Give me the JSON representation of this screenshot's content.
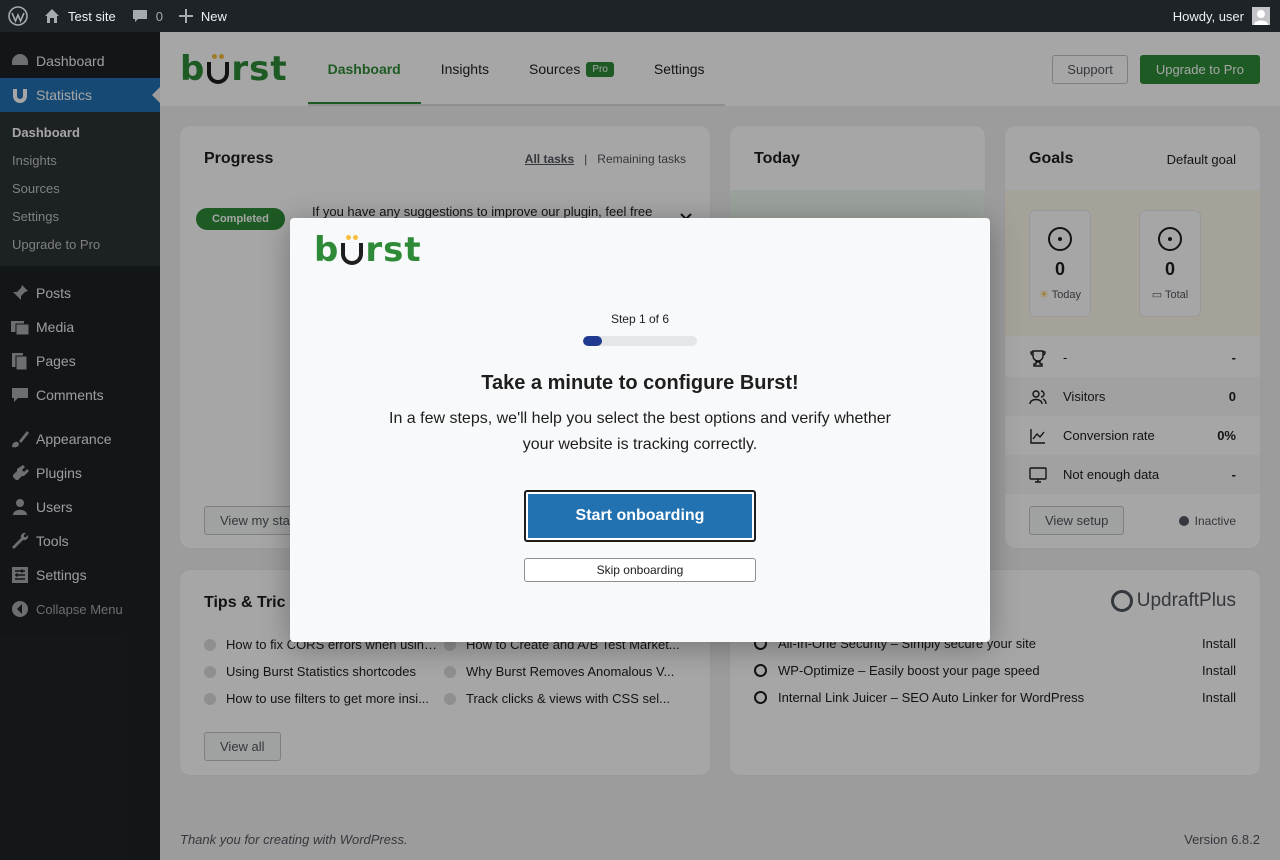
{
  "adminbar": {
    "site_name": "Test site",
    "comments_count": "0",
    "new_label": "New",
    "greeting": "Howdy, user"
  },
  "sidebar": {
    "dashboard": "Dashboard",
    "statistics": "Statistics",
    "submenu": [
      "Dashboard",
      "Insights",
      "Sources",
      "Settings",
      "Upgrade to Pro"
    ],
    "posts": "Posts",
    "media": "Media",
    "pages": "Pages",
    "comments": "Comments",
    "appearance": "Appearance",
    "plugins": "Plugins",
    "users": "Users",
    "tools": "Tools",
    "settings": "Settings",
    "collapse": "Collapse Menu"
  },
  "header": {
    "tabs": [
      "Dashboard",
      "Insights",
      "Sources",
      "Settings"
    ],
    "pro_badge": "Pro",
    "support": "Support",
    "upgrade": "Upgrade to Pro"
  },
  "progress": {
    "title": "Progress",
    "all_tasks": "All tasks",
    "separator": "|",
    "remaining_tasks": "Remaining tasks",
    "badge": "Completed",
    "task_text": "If you have any suggestions to improve our plugin, feel free",
    "button": "View my sta"
  },
  "today": {
    "title": "Today"
  },
  "goals": {
    "title": "Goals",
    "default_goal": "Default goal",
    "tiles": [
      {
        "value": "0",
        "label": "Today"
      },
      {
        "value": "0",
        "label": "Total"
      }
    ],
    "rows": [
      {
        "label": "-",
        "value": "-"
      },
      {
        "label": "Visitors",
        "value": "0"
      },
      {
        "label": "Conversion rate",
        "value": "0%"
      },
      {
        "label": "Not enough data",
        "value": "-"
      }
    ],
    "view_setup": "View setup",
    "status": "Inactive"
  },
  "tips": {
    "title": "Tips & Tric",
    "items": [
      "How to fix CORS errors when using...",
      "How to Create and A/B Test Market...",
      "Using Burst Statistics shortcodes",
      "Why Burst Removes Anomalous V...",
      "How to use filters to get more insi...",
      "Track clicks & views with CSS sel..."
    ],
    "view_all": "View all"
  },
  "plugins": {
    "brand": "UpdraftPlus",
    "items": [
      {
        "name": "All-In-One Security – Simply secure your site",
        "action": "Install"
      },
      {
        "name": "WP-Optimize – Easily boost your page speed",
        "action": "Install"
      },
      {
        "name": "Internal Link Juicer – SEO Auto Linker for WordPress",
        "action": "Install"
      }
    ]
  },
  "footer": {
    "thanks": "Thank you for creating with WordPress.",
    "version": "Version 6.8.2"
  },
  "modal": {
    "step": "Step 1 of 6",
    "progress_fraction": 0.1667,
    "title": "Take a minute to configure Burst!",
    "description": "In a few steps, we'll help you select the best options and verify whether your website is tracking correctly.",
    "start": "Start onboarding",
    "skip": "Skip onboarding"
  },
  "colors": {
    "brand_green": "#2e8a37",
    "wp_blue": "#2271b1",
    "progress_blue": "#1f3a8f"
  }
}
